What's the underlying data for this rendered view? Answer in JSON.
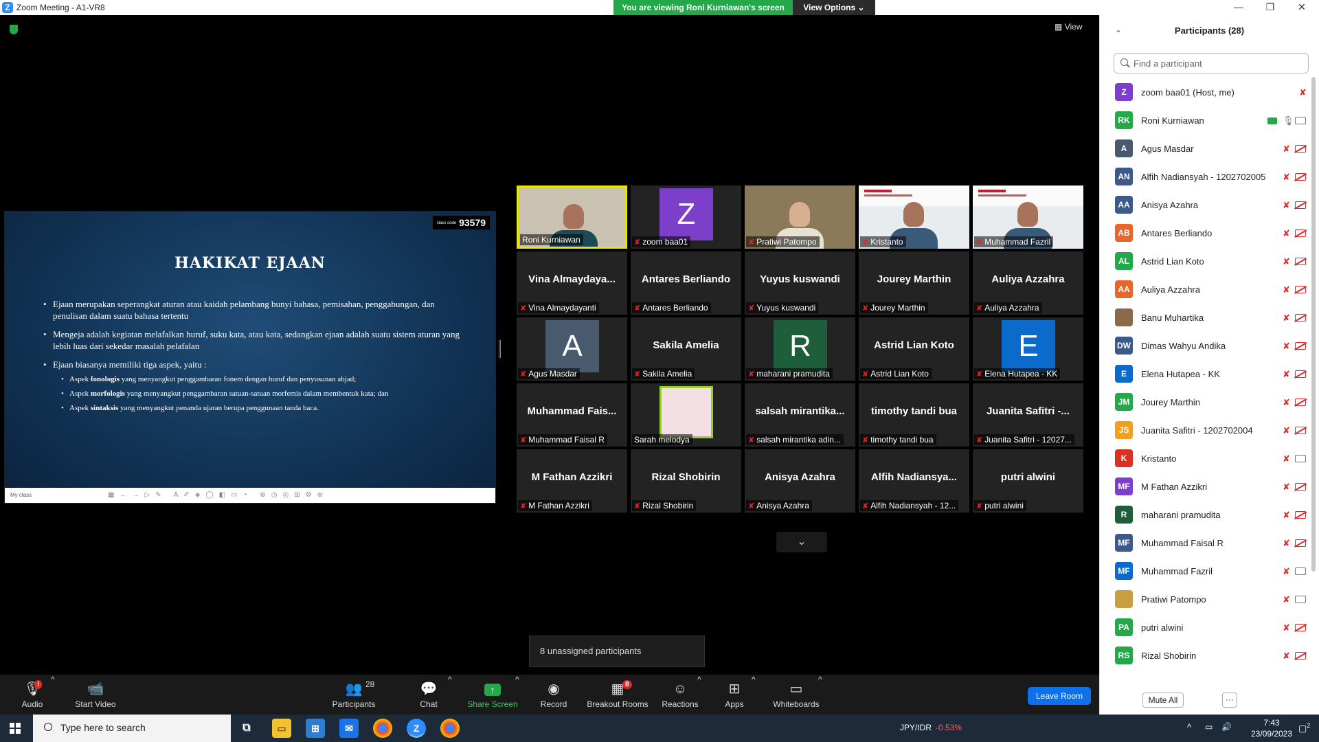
{
  "window": {
    "title": "Zoom Meeting - A1-VR8",
    "app_icon": "Z"
  },
  "banner": {
    "viewing": "You are viewing Roni Kurniawan's screen",
    "view_options": "View Options"
  },
  "view_button": "View",
  "shared_slide": {
    "class_code": "93579",
    "class_code_label": "class code",
    "title": "HAKIKAT EJAAN",
    "bullets": [
      "Ejaan merupakan seperangkat aturan atau kaidah pelambang bunyi bahasa, pemisahan, penggabungan, dan penulisan dalam suatu bahasa tertentu",
      "Mengeja adalah kegiatan melafalkan huruf, suku kata, atau kata, sedangkan ejaan adalah suatu sistem aturan yang lebih luas dari sekedar masalah pelafalan",
      "Ejaan biasanya memiliki tiga aspek, yaitu :"
    ],
    "sub_bullets": [
      {
        "pre": "Aspek ",
        "bold": "fonologis",
        "post": " yang menyangkut penggambaran fonem dengan huruf dan penyusunan abjad;"
      },
      {
        "pre": "Aspek ",
        "bold": "morfologis",
        "post": " yang menyangkut penggambaran satuan-satuan morfemis dalam membentuk kata; dan"
      },
      {
        "pre": "Aspek ",
        "bold": "sintaksis",
        "post": " yang menyangkut penanda ujaran berupa penggunaan tanda baca."
      }
    ],
    "toolbar_label": "My class"
  },
  "gallery": [
    {
      "label": "Roni Kurniawan",
      "kind": "camera",
      "active": true,
      "muted": false
    },
    {
      "label": "zoom baa01",
      "kind": "letter",
      "letter": "Z",
      "color": "#7B3FC9",
      "muted": true
    },
    {
      "label": "Pratiwi Patompo",
      "kind": "camera",
      "muted": true
    },
    {
      "label": "Kristanto",
      "kind": "camera",
      "muted": true
    },
    {
      "label": "Muhammad Fazril",
      "kind": "camera",
      "muted": true
    },
    {
      "label": "Vina Almaydayanti",
      "center": "Vina Almaydaya...",
      "kind": "name",
      "muted": true
    },
    {
      "label": "Antares Berliando",
      "center": "Antares Berliando",
      "kind": "name",
      "muted": true
    },
    {
      "label": "Yuyus kuswandi",
      "center": "Yuyus kuswandi",
      "kind": "name",
      "muted": true
    },
    {
      "label": "Jourey Marthin",
      "center": "Jourey Marthin",
      "kind": "name",
      "muted": true
    },
    {
      "label": "Auliya Azzahra",
      "center": "Auliya Azzahra",
      "kind": "name",
      "muted": true
    },
    {
      "label": "Agus Masdar",
      "kind": "letter",
      "letter": "A",
      "color": "#4A5A6E",
      "muted": true
    },
    {
      "label": "Sakila Amelia",
      "center": "Sakila Amelia",
      "kind": "name",
      "muted": true
    },
    {
      "label": "maharani pramudita",
      "kind": "letter",
      "letter": "R",
      "color": "#1E5E3A",
      "muted": true
    },
    {
      "label": "Astrid Lian Koto",
      "center": "Astrid Lian Koto",
      "kind": "name",
      "muted": true
    },
    {
      "label": "Elena Hutapea - KK",
      "kind": "letter",
      "letter": "E",
      "color": "#0B6BCB",
      "muted": true
    },
    {
      "label": "Muhammad Faisal R",
      "center": "Muhammad Fais...",
      "kind": "name",
      "muted": true
    },
    {
      "label": "Sarah melodya",
      "kind": "photo",
      "muted": false
    },
    {
      "label": "salsah mirantika adin...",
      "center": "salsah mirantika...",
      "kind": "name",
      "muted": true
    },
    {
      "label": "timothy tandi bua",
      "center": "timothy tandi bua",
      "kind": "name",
      "muted": true
    },
    {
      "label": "Juanita Safitri - 12027...",
      "center": "Juanita Safitri -...",
      "kind": "name",
      "muted": true
    },
    {
      "label": "M Fathan Azzikri",
      "center": "M Fathan Azzikri",
      "kind": "name",
      "muted": true
    },
    {
      "label": "Rizal Shobirin",
      "center": "Rizal Shobirin",
      "kind": "name",
      "muted": true
    },
    {
      "label": "Anisya Azahra",
      "center": "Anisya Azahra",
      "kind": "name",
      "muted": true
    },
    {
      "label": "Alfih Nadiansyah - 12...",
      "center": "Alfih Nadiansya...",
      "kind": "name",
      "muted": true
    },
    {
      "label": "putri alwini",
      "center": "putri alwini",
      "kind": "name",
      "muted": true
    }
  ],
  "unassigned": "8 unassigned participants",
  "controls": {
    "audio": "Audio",
    "audio_badge": "!",
    "start_video": "Start Video",
    "participants": "Participants",
    "participants_count": "28",
    "chat": "Chat",
    "share_screen": "Share Screen",
    "record": "Record",
    "breakout_rooms": "Breakout Rooms",
    "breakout_badge": "8",
    "reactions": "Reactions",
    "apps": "Apps",
    "whiteboards": "Whiteboards",
    "leave": "Leave Room"
  },
  "panel": {
    "title": "Participants (28)",
    "search_placeholder": "Find a participant",
    "participants": [
      {
        "initials": "Z",
        "name": "zoom baa01 (Host, me)",
        "color": "#7B3FC9",
        "icons": "mic"
      },
      {
        "initials": "RK",
        "name": "Roni Kurniawan",
        "color": "#23A84A",
        "icons": "share"
      },
      {
        "initials": "A",
        "name": "Agus Masdar",
        "color": "#4A5A6E",
        "icons": "both"
      },
      {
        "initials": "AN",
        "name": "Alfih Nadiansyah - 1202702005",
        "color": "#3B5A8A",
        "icons": "both"
      },
      {
        "initials": "AA",
        "name": "Anisya Azahra",
        "color": "#3B5A8A",
        "icons": "both"
      },
      {
        "initials": "AB",
        "name": "Antares Berliando",
        "color": "#E8662A",
        "icons": "both"
      },
      {
        "initials": "AL",
        "name": "Astrid Lian Koto",
        "color": "#23A84A",
        "icons": "both"
      },
      {
        "initials": "AA",
        "name": "Auliya Azzahra",
        "color": "#E8662A",
        "icons": "both"
      },
      {
        "initials": "",
        "name": "Banu Muhartika",
        "color": "#8a6a4a",
        "icons": "both"
      },
      {
        "initials": "DW",
        "name": "Dimas Wahyu Andika",
        "color": "#3B5A8A",
        "icons": "both"
      },
      {
        "initials": "E",
        "name": "Elena Hutapea - KK",
        "color": "#0B6BCB",
        "icons": "both"
      },
      {
        "initials": "JM",
        "name": "Jourey Marthin",
        "color": "#23A84A",
        "icons": "both"
      },
      {
        "initials": "JS",
        "name": "Juanita Safitri - 1202702004",
        "color": "#F0A020",
        "icons": "both"
      },
      {
        "initials": "K",
        "name": "Kristanto",
        "color": "#D93025",
        "icons": "camon"
      },
      {
        "initials": "MF",
        "name": "M Fathan Azzikri",
        "color": "#7B3FC9",
        "icons": "both"
      },
      {
        "initials": "R",
        "name": "maharani pramudita",
        "color": "#1E5E3A",
        "icons": "both"
      },
      {
        "initials": "MF",
        "name": "Muhammad Faisal R",
        "color": "#3B5A8A",
        "icons": "both"
      },
      {
        "initials": "MF",
        "name": "Muhammad Fazril",
        "color": "#0B6BCB",
        "icons": "camon"
      },
      {
        "initials": "",
        "name": "Pratiwi Patompo",
        "color": "#c8a040",
        "icons": "camon"
      },
      {
        "initials": "PA",
        "name": "putri alwini",
        "color": "#23A84A",
        "icons": "both"
      },
      {
        "initials": "RS",
        "name": "Rizal Shobirin",
        "color": "#23A84A",
        "icons": "both"
      }
    ],
    "mute_all": "Mute All",
    "more": "···"
  },
  "taskbar": {
    "search_placeholder": "Type here to search",
    "fx_pair": "JPY/IDR",
    "fx_change": "-0.53%",
    "time": "7:43",
    "date": "23/09/2023",
    "notification_count": "2"
  }
}
